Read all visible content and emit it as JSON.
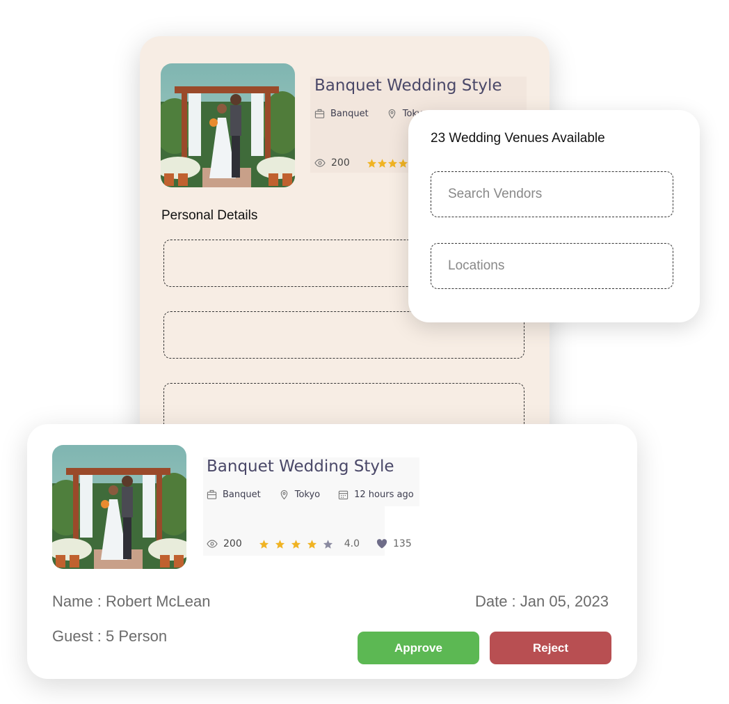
{
  "back_card": {
    "venue": {
      "title": "Banquet Wedding Style",
      "category": "Banquet",
      "location": "Tokyo",
      "views": "200",
      "rating_value": 4
    },
    "section_title": "Personal Details",
    "fields": [
      "",
      "",
      ""
    ]
  },
  "search_card": {
    "available_text": "23 Wedding Venues Available",
    "search_placeholder": "Search Vendors",
    "location_placeholder": "Locations"
  },
  "front_card": {
    "venue": {
      "title": "Banquet Wedding Style",
      "category": "Banquet",
      "location": "Tokyo",
      "posted": "12 hours ago",
      "views": "200",
      "rating": "4.0",
      "rating_value": 4,
      "likes": "135"
    },
    "name_text": "Name : Robert McLean",
    "guest_text": "Guest : 5 Person",
    "date_text": "Date : Jan 05, 2023",
    "approve_label": "Approve",
    "reject_label": "Reject"
  },
  "colors": {
    "back_card_bg": "#f7ede4",
    "title_color": "#4a4868",
    "star_color": "#f0b323",
    "approve": "#5cb853",
    "reject": "#b84f52"
  },
  "icons": [
    "briefcase-icon",
    "location-pin-icon",
    "calendar-icon",
    "eye-icon",
    "star-icon",
    "heart-icon"
  ]
}
